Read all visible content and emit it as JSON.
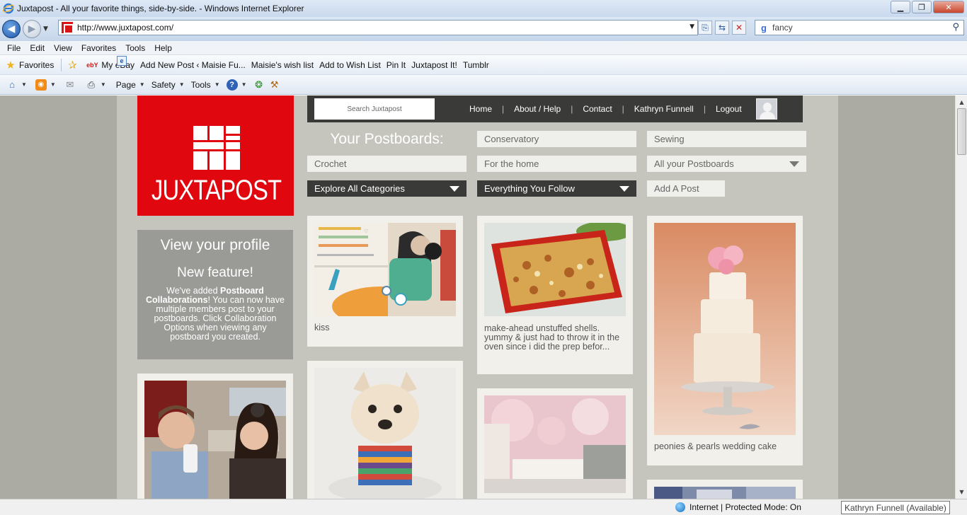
{
  "window": {
    "title": "Juxtapost - All your favorite things, side-by-side. - Windows Internet Explorer",
    "minimize": "▁",
    "maximize": "❐",
    "close": "✕"
  },
  "address_bar": {
    "url": "http://www.juxtapost.com/",
    "search_value": "fancy",
    "search_engine_icon": "g"
  },
  "menu": [
    "File",
    "Edit",
    "View",
    "Favorites",
    "Tools",
    "Help"
  ],
  "favorites_bar": {
    "favorites_label": "Favorites",
    "items": [
      {
        "label": "My eBay",
        "icon": "ebay-icon",
        "glyph": "ebY"
      },
      {
        "label": "Add New Post ‹ Maisie Fu...",
        "icon": "page-icon",
        "glyph": "e"
      },
      {
        "label": "Maisie's wish list",
        "icon": "page-icon",
        "glyph": "e"
      },
      {
        "label": "Add to Wish List",
        "icon": "page-icon",
        "glyph": "e"
      },
      {
        "label": "Pin It",
        "icon": "page-icon",
        "glyph": "e"
      },
      {
        "label": "Juxtapost It!",
        "icon": "page-icon",
        "glyph": "e"
      },
      {
        "label": "Tumblr",
        "icon": "page-icon",
        "glyph": "e"
      }
    ]
  },
  "command_bar": {
    "page": "Page",
    "safety": "Safety",
    "tools": "Tools"
  },
  "site": {
    "logo_text": "JUXTAPOST",
    "search_placeholder": "Search Juxtapost",
    "nav": [
      "Home",
      "About / Help",
      "Contact",
      "Kathryn Funnell",
      "Logout"
    ],
    "nav_separator": "|",
    "postboards_heading": "Your Postboards:",
    "postboards": {
      "conservatory": "Conservatory",
      "sewing": "Sewing",
      "crochet": "Crochet",
      "for_the_home": "For the home",
      "all_postboards": "All your Postboards",
      "explore": "Explore All Categories",
      "following": "Everything You Follow",
      "add_post": "Add A Post"
    },
    "profile": {
      "link": "View your profile",
      "feature_title": "New feature!",
      "feature_pre": "We've added ",
      "feature_bold": "Postboard Collaborations",
      "feature_post": "! You can now have multiple members post to your postboards. Click Collaboration Options when viewing any postboard you created."
    },
    "posts": [
      {
        "caption": "kiss",
        "image": "illustration of couple kissing at table"
      },
      {
        "caption": "make-ahead unstuffed shells. yummy & just had to throw it in the oven since i did the prep befor...",
        "image": "pasta casserole in red dish"
      },
      {
        "caption": "peonies & pearls wedding cake",
        "image": "white tiered wedding cake with pink flowers"
      },
      {
        "caption": "",
        "image": "french bulldog in striped sweater"
      },
      {
        "caption": "",
        "image": "pink bedroom with floral mural"
      },
      {
        "caption": "",
        "image": "couple laughing at party"
      }
    ]
  },
  "status": {
    "zone": "Internet | Protected Mode: On",
    "tooltip": "Kathryn Funnell (Available)"
  }
}
